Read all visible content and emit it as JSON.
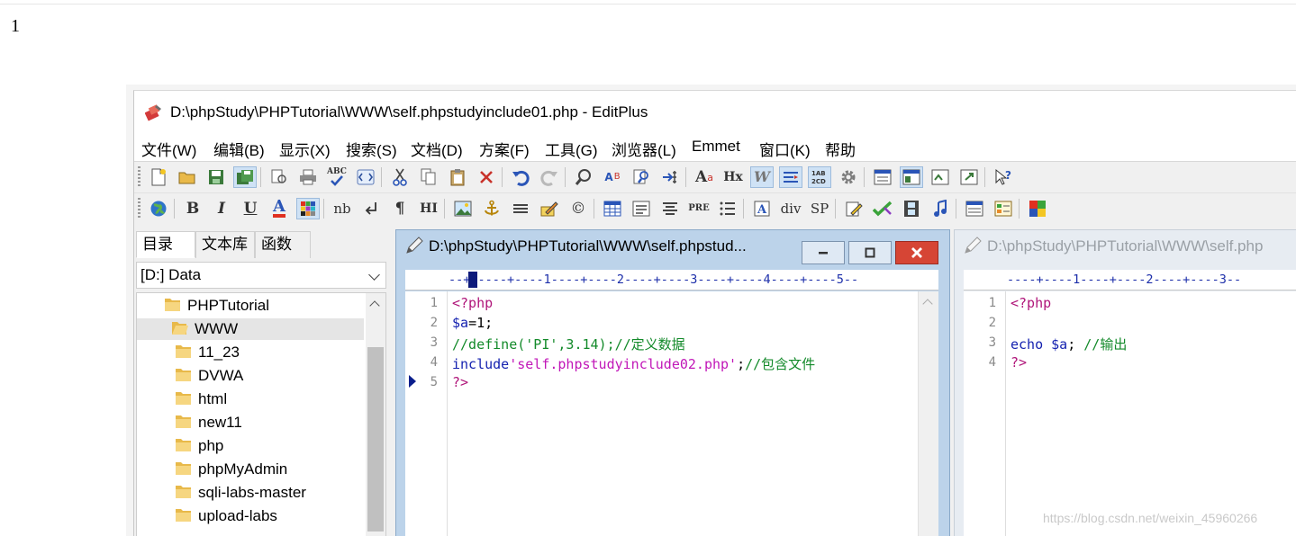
{
  "page": {
    "text": "1",
    "watermark": "https://blog.csdn.net/weixin_45960266"
  },
  "window": {
    "title": "D:\\phpStudy\\PHPTutorial\\WWW\\self.phpstudyinclude01.php - EditPlus"
  },
  "menu": [
    "文件(W)",
    "编辑(B)",
    "显示(X)",
    "搜索(S)",
    "文档(D)",
    "方案(F)",
    "工具(G)",
    "浏览器(L)",
    "Emmet",
    "窗口(K)",
    "帮助"
  ],
  "toolbar2_text": {
    "bold": "B",
    "italic": "I",
    "underline": "U",
    "font_color": "A",
    "nb": "nb",
    "pilcrow": "¶",
    "hi": "HI",
    "copyright": "©",
    "pre": "PRE",
    "div": "div",
    "sp": "SP",
    "hx": "Hx",
    "abc": "ABC"
  },
  "left_panel": {
    "tabs": [
      "目录",
      "文本库",
      "函数"
    ],
    "drive": "[D:] Data",
    "tree": [
      {
        "label": "PHPTutorial",
        "level": 0
      },
      {
        "label": "WWW",
        "level": 1,
        "selected": true
      },
      {
        "label": "11_23",
        "level": 2
      },
      {
        "label": "DVWA",
        "level": 2
      },
      {
        "label": "html",
        "level": 2
      },
      {
        "label": "new11",
        "level": 2
      },
      {
        "label": "php",
        "level": 2
      },
      {
        "label": "phpMyAdmin",
        "level": 2
      },
      {
        "label": "sqli-labs-master",
        "level": 2
      },
      {
        "label": "upload-labs",
        "level": 2
      }
    ]
  },
  "editor1": {
    "title": "D:\\phpStudy\\PHPTutorial\\WWW\\self.phpstud...",
    "ruler": "--+-----+----1----+----2----+----3----+----4----+----5--",
    "lines": [
      {
        "n": "1",
        "parts": [
          [
            "tag",
            "<?php"
          ]
        ]
      },
      {
        "n": "2",
        "parts": [
          [
            "var",
            "$a"
          ],
          [
            "op",
            "=1;"
          ]
        ]
      },
      {
        "n": "3",
        "parts": [
          [
            "cmt",
            "//define('PI',3.14);//定义数据"
          ]
        ]
      },
      {
        "n": "4",
        "parts": [
          [
            "kw",
            "include"
          ],
          [
            "str",
            "'self.phpstudyinclude02.php'"
          ],
          [
            "op",
            ";"
          ],
          [
            "cmt",
            "//包含文件"
          ]
        ]
      },
      {
        "n": "5",
        "parts": [
          [
            "tag",
            "?>"
          ]
        ]
      }
    ]
  },
  "editor2": {
    "title": "D:\\phpStudy\\PHPTutorial\\WWW\\self.php",
    "ruler": "----+----1----+----2----+----3--",
    "lines": [
      {
        "n": "1",
        "parts": [
          [
            "tag",
            "<?php"
          ]
        ]
      },
      {
        "n": "2",
        "parts": []
      },
      {
        "n": "3",
        "parts": [
          [
            "kw",
            "echo "
          ],
          [
            "var",
            "$a"
          ],
          [
            "op",
            "; "
          ],
          [
            "cmt",
            "//输出"
          ]
        ]
      },
      {
        "n": "4",
        "parts": [
          [
            "tag",
            "?>"
          ]
        ]
      }
    ]
  }
}
